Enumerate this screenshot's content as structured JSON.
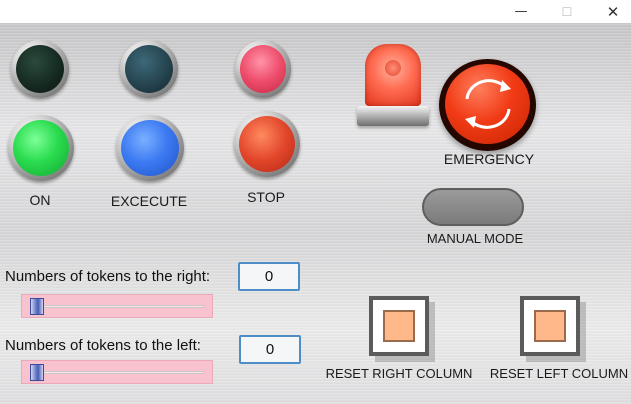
{
  "window": {
    "minimize_glyph": "—",
    "maximize_glyph": "☐",
    "close_glyph": "✕"
  },
  "indicators": {
    "top_row": [
      {
        "name": "dark-green-lamp",
        "color": "#14281f"
      },
      {
        "name": "dark-teal-lamp",
        "color": "#23414c"
      },
      {
        "name": "pink-lamp",
        "color": "#ee4c6a"
      }
    ],
    "bottom_row": [
      {
        "name": "on-lamp",
        "color": "#2bdc4f",
        "label": "ON"
      },
      {
        "name": "execute-lamp",
        "color": "#3d7bf2",
        "label": "EXCECUTE"
      },
      {
        "name": "stop-lamp",
        "color": "#e2462b",
        "label": "STOP"
      }
    ]
  },
  "emergency": {
    "label": "EMERGENCY",
    "beacon_color": "#ff6b50",
    "button_color": "#f13b16",
    "icon": "rotate-arrows-icon"
  },
  "manual_mode": {
    "label": "MANUAL MODE",
    "color": "#8a8a8a"
  },
  "tokens": {
    "right_label": "Numbers of tokens to the right:",
    "right_value": "0",
    "left_label": "Numbers of tokens to the left:",
    "left_value": "0",
    "right_slider_fraction": 0.0,
    "left_slider_fraction": 0.0,
    "slider_color": "#f8c3cf"
  },
  "reset": {
    "right_label": "RESET RIGHT COLUMN",
    "left_label": "RESET LEFT COLUMN",
    "square_color": "#ffb88a"
  }
}
